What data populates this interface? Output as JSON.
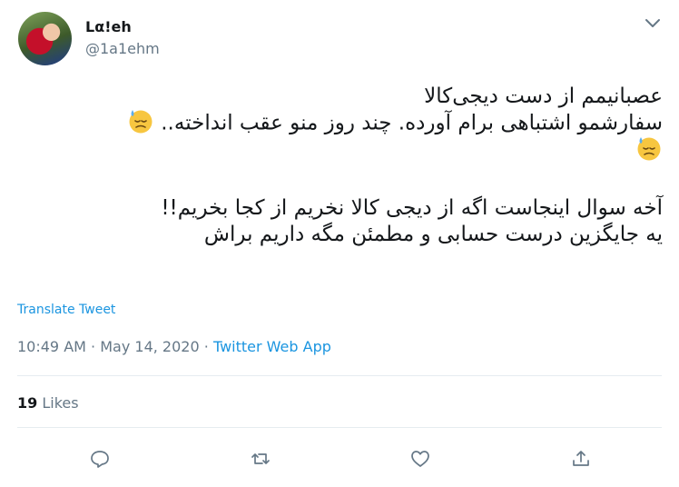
{
  "author": {
    "display_name": "Lα!eh",
    "handle": "@1a1ehm"
  },
  "tweet": {
    "lines": [
      "عصبانیمم از دست دیجی‌کالا",
      "سفارشمو اشتباهی برام آورده. چند روز منو عقب انداخته..",
      "",
      "آخه سوال اینجاست اگه از دیجی کالا نخریم از کجا بخریم!!",
      "یه جایگزین درست حسابی و مطمئن مگه داریم براش"
    ],
    "emoji": "downcast-face-with-sweat"
  },
  "translate_label": "Translate Tweet",
  "meta": {
    "time": "10:49 AM",
    "date": "May 14, 2020",
    "separator": "·",
    "source": "Twitter Web App"
  },
  "stats": {
    "likes_count": "19",
    "likes_label": "Likes"
  },
  "actions": {
    "reply_icon": "reply-icon",
    "retweet_icon": "retweet-icon",
    "like_icon": "heart-icon",
    "share_icon": "share-icon"
  },
  "colors": {
    "link": "#1b95e0",
    "muted": "#657786",
    "text": "#14171a",
    "divider": "#e6ecf0"
  }
}
